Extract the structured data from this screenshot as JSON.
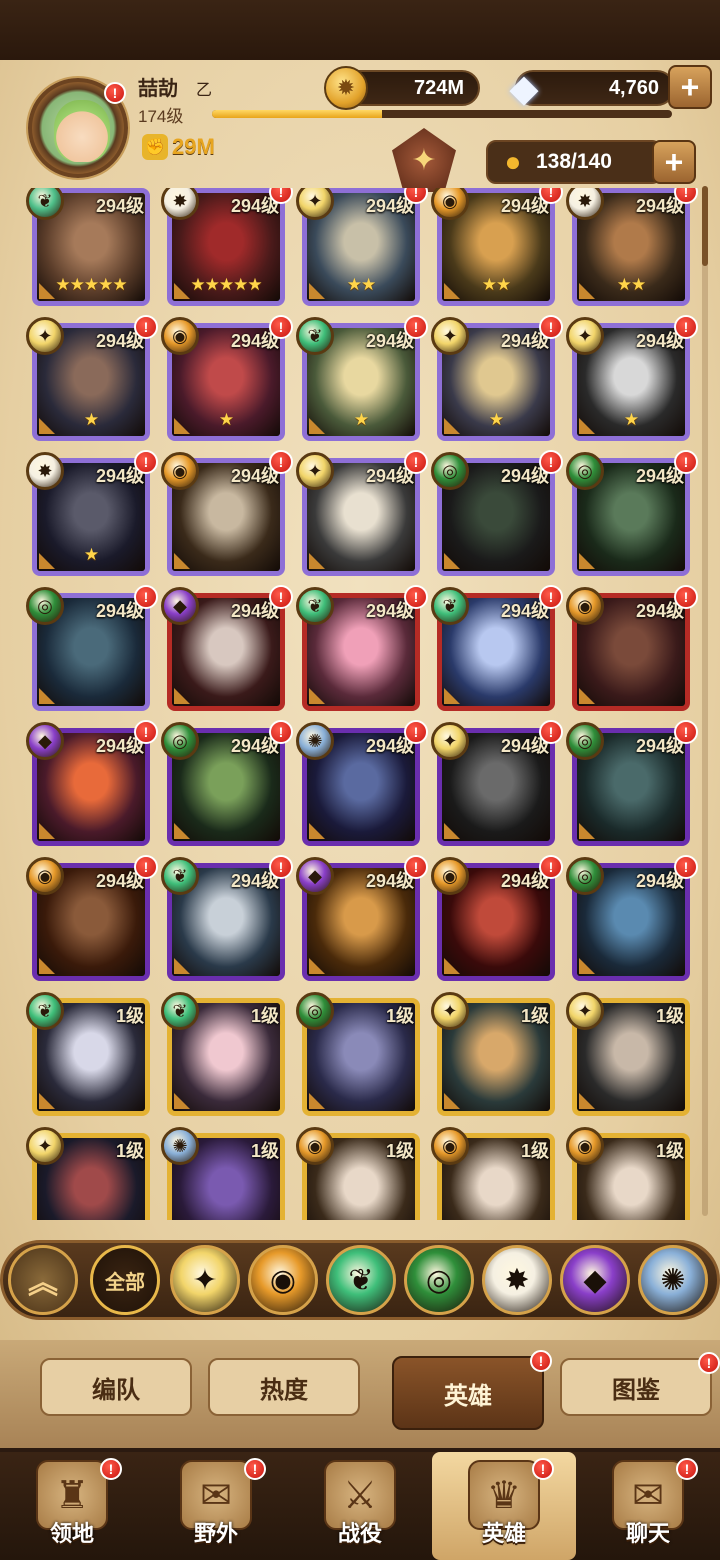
{
  "player": {
    "name": "喆劼",
    "name_suffix": "乙",
    "level": "174级",
    "xp_fraction": 0.37,
    "power": "29M"
  },
  "resources": {
    "gold": "724M",
    "gems": "4,760",
    "hero_count": "138/140"
  },
  "heroes": [
    {
      "level": "294级",
      "stars": "★★★★★",
      "faction": "forest",
      "rarity": "purple",
      "alert": false
    },
    {
      "level": "294级",
      "stars": "★★★★★",
      "faction": "celestial",
      "rarity": "purple",
      "alert": true
    },
    {
      "level": "294级",
      "stars": "★★",
      "faction": "lightbearer",
      "rarity": "purple",
      "alert": true
    },
    {
      "level": "294级",
      "stars": "★★",
      "faction": "mauler",
      "rarity": "purple",
      "alert": true
    },
    {
      "level": "294级",
      "stars": "★★",
      "faction": "celestial",
      "rarity": "purple",
      "alert": true
    },
    {
      "level": "294级",
      "stars": "★",
      "faction": "lightbearer",
      "rarity": "purple",
      "alert": true
    },
    {
      "level": "294级",
      "stars": "★",
      "faction": "mauler",
      "rarity": "purple",
      "alert": true
    },
    {
      "level": "294级",
      "stars": "★",
      "faction": "wilder",
      "rarity": "purple",
      "alert": true
    },
    {
      "level": "294级",
      "stars": "★",
      "faction": "lightbearer",
      "rarity": "purple",
      "alert": true
    },
    {
      "level": "294级",
      "stars": "★",
      "faction": "lightbearer",
      "rarity": "purple",
      "alert": true
    },
    {
      "level": "294级",
      "stars": "★",
      "faction": "celestial",
      "rarity": "purple",
      "alert": true
    },
    {
      "level": "294级",
      "stars": "",
      "faction": "mauler",
      "rarity": "purple",
      "alert": true
    },
    {
      "level": "294级",
      "stars": "",
      "faction": "lightbearer",
      "rarity": "purple",
      "alert": true
    },
    {
      "level": "294级",
      "stars": "",
      "faction": "graveborn",
      "rarity": "purple",
      "alert": true
    },
    {
      "level": "294级",
      "stars": "",
      "faction": "graveborn",
      "rarity": "purple",
      "alert": true
    },
    {
      "level": "294级",
      "stars": "",
      "faction": "graveborn",
      "rarity": "purple",
      "alert": true
    },
    {
      "level": "294级",
      "stars": "",
      "faction": "hypogean",
      "rarity": "red",
      "alert": true
    },
    {
      "level": "294级",
      "stars": "",
      "faction": "wilder",
      "rarity": "red",
      "alert": true
    },
    {
      "level": "294级",
      "stars": "",
      "faction": "wilder",
      "rarity": "red",
      "alert": true
    },
    {
      "level": "294级",
      "stars": "",
      "faction": "mauler",
      "rarity": "red",
      "alert": true
    },
    {
      "level": "294级",
      "stars": "",
      "faction": "hypogean",
      "rarity": "violet",
      "alert": true
    },
    {
      "level": "294级",
      "stars": "",
      "faction": "graveborn",
      "rarity": "violet",
      "alert": true
    },
    {
      "level": "294级",
      "stars": "",
      "faction": "dimensional",
      "rarity": "violet",
      "alert": true
    },
    {
      "level": "294级",
      "stars": "",
      "faction": "lightbearer",
      "rarity": "violet",
      "alert": true
    },
    {
      "level": "294级",
      "stars": "",
      "faction": "graveborn",
      "rarity": "violet",
      "alert": true
    },
    {
      "level": "294级",
      "stars": "",
      "faction": "mauler",
      "rarity": "violet",
      "alert": true
    },
    {
      "level": "294级",
      "stars": "",
      "faction": "wilder",
      "rarity": "violet",
      "alert": true
    },
    {
      "level": "294级",
      "stars": "",
      "faction": "hypogean",
      "rarity": "violet",
      "alert": true
    },
    {
      "level": "294级",
      "stars": "",
      "faction": "mauler",
      "rarity": "violet",
      "alert": true
    },
    {
      "level": "294级",
      "stars": "",
      "faction": "graveborn",
      "rarity": "violet",
      "alert": true
    },
    {
      "level": "1级",
      "stars": "",
      "faction": "wilder",
      "rarity": "gold",
      "alert": false
    },
    {
      "level": "1级",
      "stars": "",
      "faction": "wilder",
      "rarity": "gold",
      "alert": false
    },
    {
      "level": "1级",
      "stars": "",
      "faction": "graveborn",
      "rarity": "gold",
      "alert": false
    },
    {
      "level": "1级",
      "stars": "",
      "faction": "lightbearer",
      "rarity": "gold",
      "alert": false
    },
    {
      "level": "1级",
      "stars": "",
      "faction": "lightbearer",
      "rarity": "gold",
      "alert": false
    },
    {
      "level": "1级",
      "stars": "",
      "faction": "lightbearer",
      "rarity": "gold",
      "alert": false
    },
    {
      "level": "1级",
      "stars": "",
      "faction": "dimensional",
      "rarity": "gold",
      "alert": false
    },
    {
      "level": "1级",
      "stars": "",
      "faction": "mauler",
      "rarity": "gold",
      "alert": false
    },
    {
      "level": "1级",
      "stars": "",
      "faction": "mauler",
      "rarity": "gold",
      "alert": false
    },
    {
      "level": "1级",
      "stars": "",
      "faction": "mauler",
      "rarity": "gold",
      "alert": false
    }
  ],
  "faction_colors": {
    "lightbearer": "#f2d56a",
    "mauler": "#e79a2a",
    "wilder": "#3fbf7a",
    "graveborn": "#2f8f3a",
    "celestial": "#f5f0e2",
    "hypogean": "#8a3fc9",
    "dimensional": "#8ab0d8",
    "forest": "#4fc08a"
  },
  "faction_icons": {
    "lightbearer": "✦",
    "mauler": "◉",
    "wilder": "❦",
    "graveborn": "◎",
    "celestial": "✸",
    "hypogean": "◆",
    "dimensional": "✺",
    "forest": "❦"
  },
  "filters": {
    "up_icon": "chevron-up-icon",
    "all_label": "全部",
    "items": [
      "lightbearer",
      "mauler",
      "wilder",
      "graveborn",
      "celestial",
      "hypogean",
      "dimensional"
    ]
  },
  "subtabs": [
    {
      "label": "编队",
      "active": false,
      "alert": false
    },
    {
      "label": "热度",
      "active": false,
      "alert": false
    },
    {
      "label": "英雄",
      "active": true,
      "alert": true
    },
    {
      "label": "图鉴",
      "active": false,
      "alert": true
    }
  ],
  "nav": [
    {
      "label": "领地",
      "icon": "castle-icon",
      "glyph": "♜",
      "active": false,
      "alert": true
    },
    {
      "label": "野外",
      "icon": "map-scroll-icon",
      "glyph": "✉",
      "active": false,
      "alert": true
    },
    {
      "label": "战役",
      "icon": "sword-shield-icon",
      "glyph": "⚔",
      "active": false,
      "alert": false
    },
    {
      "label": "英雄",
      "icon": "helmet-icon",
      "glyph": "♛",
      "active": true,
      "alert": true
    },
    {
      "label": "聊天",
      "icon": "chat-bubble-icon",
      "glyph": "✉",
      "active": false,
      "alert": true
    }
  ],
  "alert_mark": "!"
}
